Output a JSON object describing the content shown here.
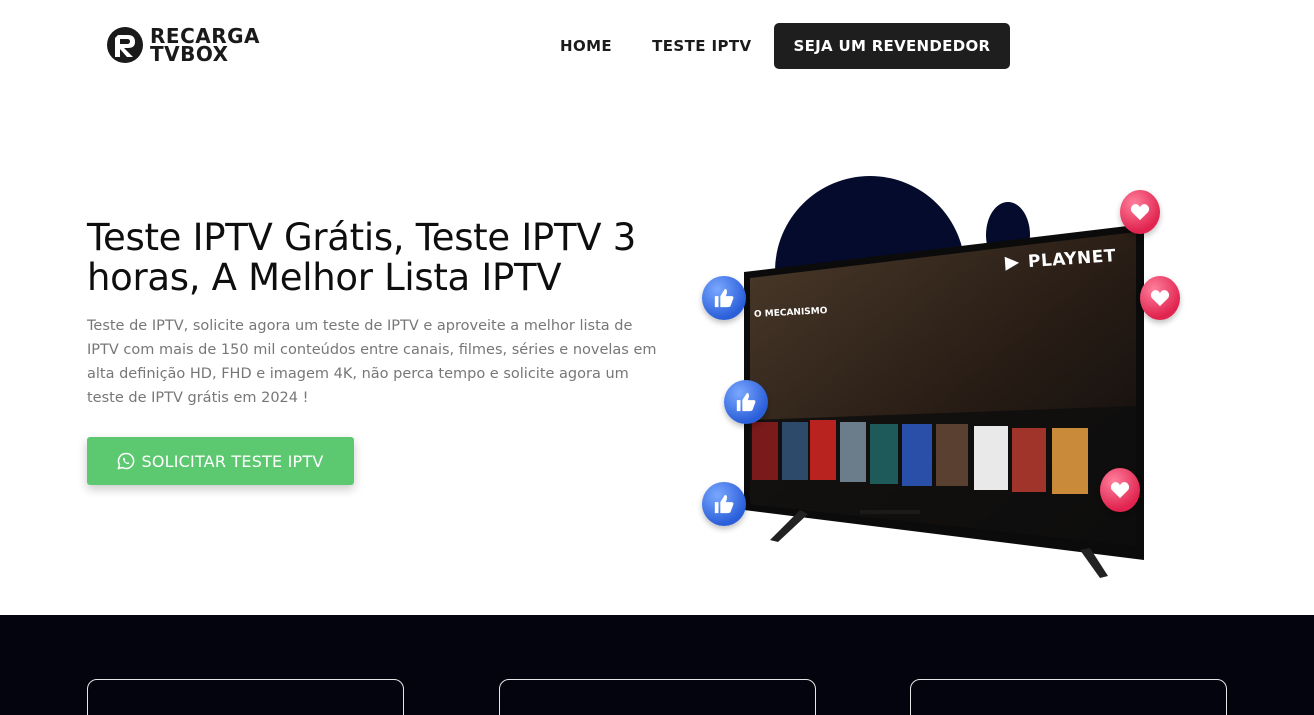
{
  "brand": {
    "line1": "RECARGA",
    "line2": "TVBOX"
  },
  "nav": {
    "items": [
      "HOME",
      "TESTE IPTV"
    ],
    "cta": "SEJA UM REVENDEDOR"
  },
  "hero": {
    "title": "Teste IPTV Grátis, Teste IPTV 3 horas, A Melhor Lista IPTV",
    "description": "Teste de IPTV, solicite agora um teste de IPTV e aproveite a melhor lista de IPTV com mais de 150 mil conteúdos entre canais, filmes, séries e novelas em alta definição HD, FHD e imagem 4K, não perca tempo e solicite agora um teste de IPTV grátis em 2024 !",
    "button": "SOLICITAR TESTE IPTV"
  },
  "tv": {
    "brand": "PLAYNET",
    "feature_title": "O MECANISMO"
  },
  "icons": {
    "logo": "recarga-logo-icon",
    "button": "whatsapp-icon",
    "like": "thumbs-up-icon",
    "heart": "heart-icon"
  },
  "colors": {
    "accent": "#5cc971",
    "nav_cta_bg": "#1e1e1e",
    "dark_band": "#03040d",
    "blob": "#050b2c"
  }
}
